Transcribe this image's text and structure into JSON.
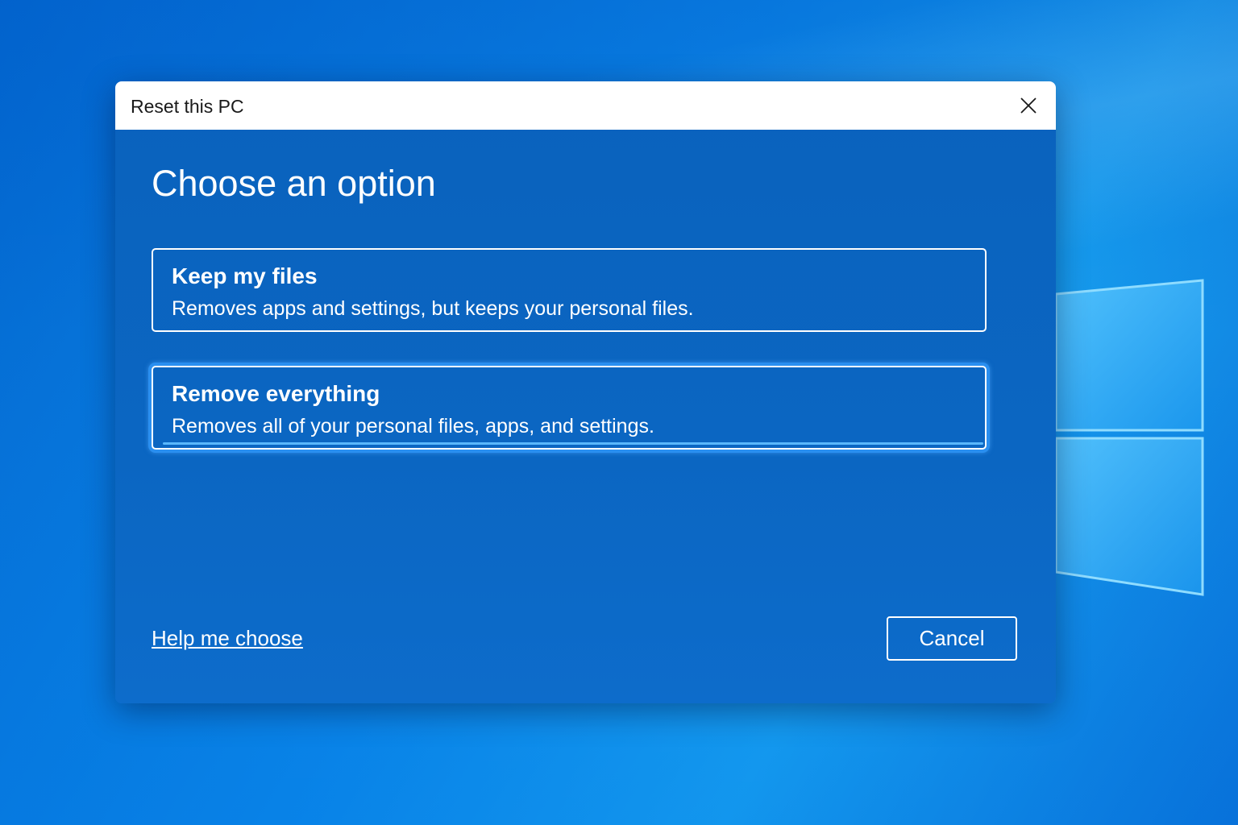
{
  "window": {
    "title": "Reset this PC",
    "close_icon": "close-icon"
  },
  "dialog": {
    "heading": "Choose an option",
    "options": [
      {
        "title": "Keep my files",
        "description": "Removes apps and settings, but keeps your personal files.",
        "focused": false
      },
      {
        "title": "Remove everything",
        "description": "Removes all of your personal files, apps, and settings.",
        "focused": true
      }
    ],
    "help_link": "Help me choose",
    "cancel_label": "Cancel"
  },
  "colors": {
    "dialog_background": "#0b66c2",
    "titlebar_background": "#ffffff",
    "focus_ring": "#2a8ff0",
    "text_on_dialog": "#ffffff"
  },
  "desktop": {
    "logo_icon": "windows-logo-icon"
  }
}
